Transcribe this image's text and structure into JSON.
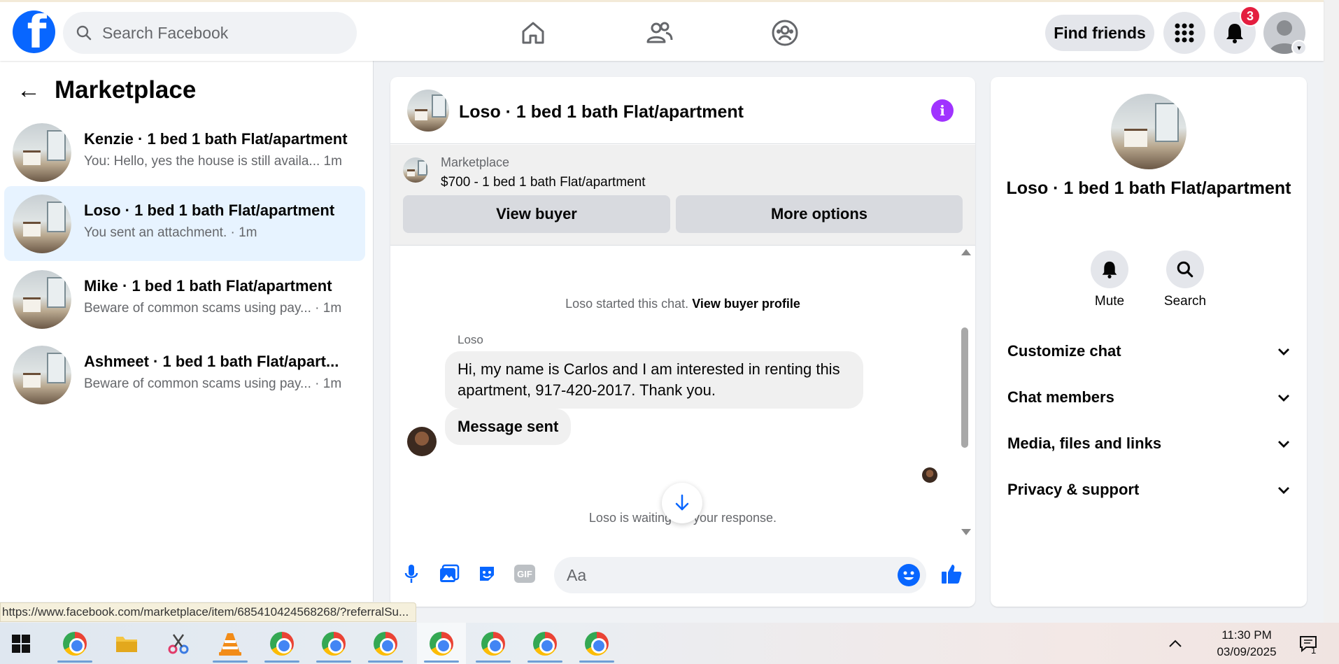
{
  "topbar": {
    "logo_letter": "f",
    "search_placeholder": "Search Facebook",
    "find_friends_label": "Find friends",
    "notification_count": "3"
  },
  "sidebar": {
    "title": "Marketplace",
    "conversations": [
      {
        "name": "Kenzie · 1 bed 1 bath Flat/apartment",
        "preview": "You: Hello, yes the house is still availa...  1m",
        "active": false
      },
      {
        "name": "Loso · 1 bed 1 bath Flat/apartment",
        "preview": "You sent an attachment. · 1m",
        "active": true
      },
      {
        "name": "Mike · 1 bed 1 bath Flat/apartment",
        "preview": "Beware of common scams using pay...  · 1m",
        "active": false
      },
      {
        "name": "Ashmeet · 1 bed 1 bath Flat/apart...",
        "preview": "Beware of common scams using pay...  · 1m",
        "active": false
      }
    ]
  },
  "chat": {
    "title": "Loso · 1 bed 1 bath Flat/apartment",
    "info_glyph": "i",
    "marketplace_label": "Marketplace",
    "listing": "$700 - 1 bed 1 bath Flat/apartment",
    "view_buyer_label": "View buyer",
    "more_options_label": "More options",
    "started_text": "Loso started this chat.",
    "view_buyer_profile": "View buyer profile",
    "sender_name": "Loso",
    "message_1": "Hi, my name is Carlos and I am interested in renting this apartment, 917-420-2017. Thank you.",
    "message_2": "Message sent",
    "waiting_text": "Loso is waiting for your response.",
    "composer_placeholder": "Aa",
    "gif_label": "GIF"
  },
  "details": {
    "title": "Loso · 1 bed 1 bath Flat/apartment",
    "mute_label": "Mute",
    "search_label": "Search",
    "sections": [
      "Customize chat",
      "Chat members",
      "Media, files and links",
      "Privacy & support"
    ]
  },
  "status_url": "https://www.facebook.com/marketplace/item/685410424568268/?referralSu...",
  "taskbar": {
    "time": "11:30 PM",
    "date": "03/09/2025",
    "notif_count": "1"
  },
  "colors": {
    "brand": "#0866ff",
    "active_row": "#e7f3ff",
    "info": "#a033ff",
    "badge": "#e41e3f"
  }
}
